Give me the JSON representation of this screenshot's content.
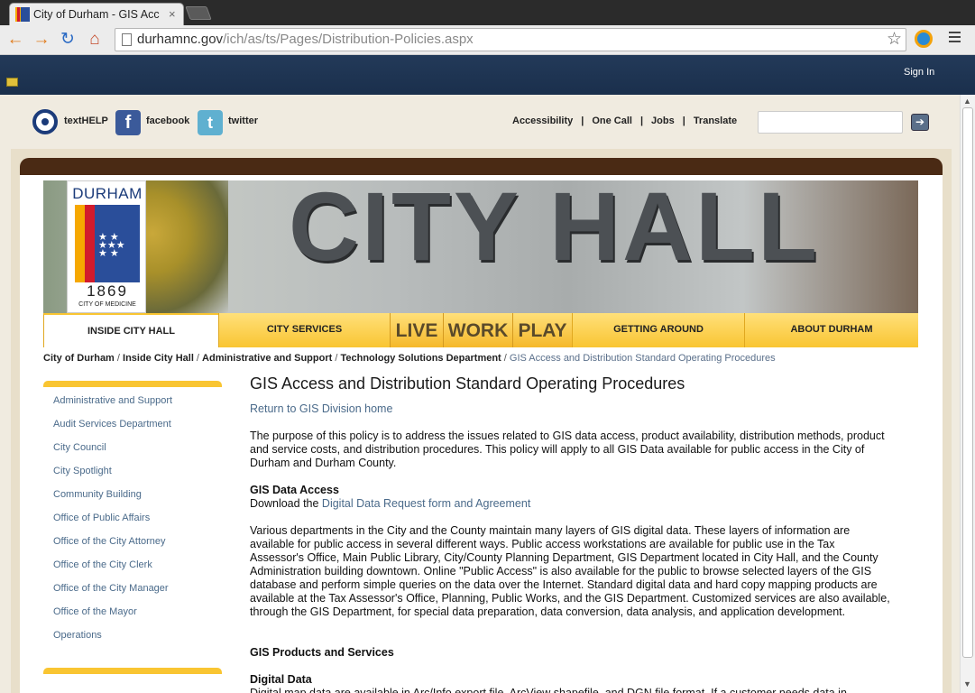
{
  "browser": {
    "tab_title": "City of Durham - GIS Acce",
    "tab_close": "×",
    "url_host": "durhamnc.gov",
    "url_path": "/ich/as/ts/Pages/Distribution-Policies.aspx",
    "back_icon": "arrow-left-icon",
    "forward_icon": "arrow-right-icon",
    "reload_icon": "reload-icon",
    "home_icon": "home-icon"
  },
  "site_bar": {
    "sign_in": "Sign In"
  },
  "utility": {
    "texthelp": "textHELP",
    "facebook": "facebook",
    "twitter": "twitter",
    "links": [
      "Accessibility",
      "One Call",
      "Jobs",
      "Translate"
    ],
    "search_value": ""
  },
  "banner": {
    "heading": "CITY HALL",
    "logo_top": "DURHAM",
    "logo_year": "1869",
    "logo_sub": "CITY OF MEDICINE"
  },
  "nav": {
    "items": [
      "INSIDE CITY HALL",
      "CITY SERVICES",
      "LIVE",
      "WORK",
      "PLAY",
      "GETTING AROUND",
      "ABOUT DURHAM"
    ]
  },
  "breadcrumb": {
    "items": [
      "City of Durham",
      "Inside City Hall",
      "Administrative and Support",
      "Technology Solutions Department"
    ],
    "current": "GIS Access and Distribution Standard Operating Procedures"
  },
  "sidebar": {
    "items": [
      "Administrative and Support",
      "Audit Services Department",
      "City Council",
      "City Spotlight",
      "Community Building",
      "Office of Public Affairs",
      "Office of the City Attorney",
      "Office of the City Clerk",
      "Office of the City Manager",
      "Office of the Mayor",
      "Operations"
    ]
  },
  "main": {
    "title": "GIS Access and Distribution Standard Operating Procedures",
    "return_link": "Return to GIS Division home",
    "intro": "The purpose of this policy is to address the issues related to GIS data access, product availability, distribution methods, product and service costs, and distribution procedures. This policy will apply to all GIS Data available for public access in the City of Durham and Durham County.",
    "access_heading": "GIS Data Access",
    "download_prefix": "Download the ",
    "download_link": "Digital Data Request form and Agreement",
    "various": "Various departments in the City and the County maintain many layers of GIS digital data. These layers of information are available for public access in several different ways. Public access workstations are available for public use in the Tax Assessor's Office, Main Public Library, City/County Planning Department, GIS Department located in City Hall, and the County Administration building downtown. Online \"Public Access\" is also available for the public to browse selected layers of the GIS database and perform simple queries on the data over the Internet. Standard digital data and hard copy mapping products are available at the Tax Assessor's Office, Planning, Public Works, and the GIS Department. Customized services are also available, through the GIS Department, for special data preparation, data conversion, data analysis, and application development.",
    "products_heading": "GIS Products and Services",
    "digital_heading": "Digital Data",
    "digital_text": "Digital map data are available in Arc/Info export file, ArcView shapefile, and DGN file format. If a customer needs data in"
  }
}
